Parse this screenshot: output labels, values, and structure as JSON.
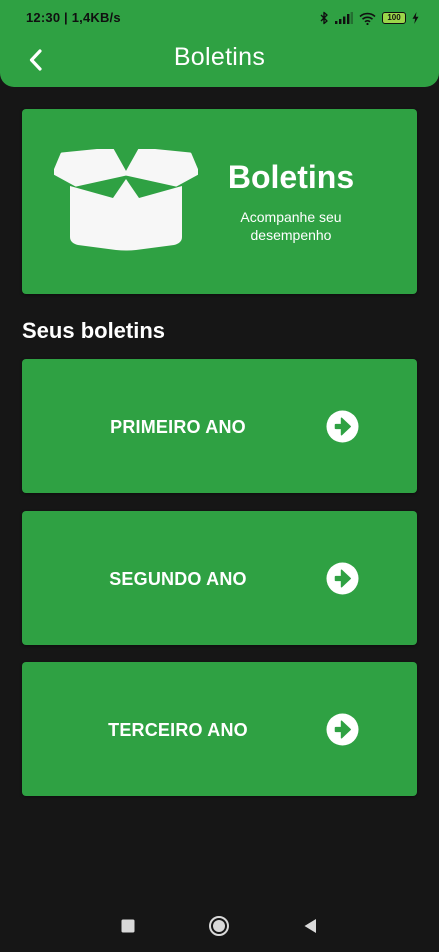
{
  "status_bar": {
    "time": "12:30 | 1,4KB/s",
    "battery_level": "100"
  },
  "app_bar": {
    "title": "Boletins"
  },
  "hero": {
    "title": "Boletins",
    "subtitle": "Acompanhe seu desempenho",
    "icon": "open-box-icon"
  },
  "section": {
    "title": "Seus boletins"
  },
  "years": [
    {
      "label": "PRIMEIRO ANO",
      "icon": "arrow-right-circle-icon"
    },
    {
      "label": "SEGUNDO ANO",
      "icon": "arrow-right-circle-icon"
    },
    {
      "label": "TERCEIRO ANO",
      "icon": "arrow-right-circle-icon"
    }
  ],
  "colors": {
    "accent": "#2fa143",
    "background": "#161616"
  },
  "nav_bar": {
    "icons": [
      "recent-apps-icon",
      "home-icon",
      "back-icon"
    ]
  }
}
